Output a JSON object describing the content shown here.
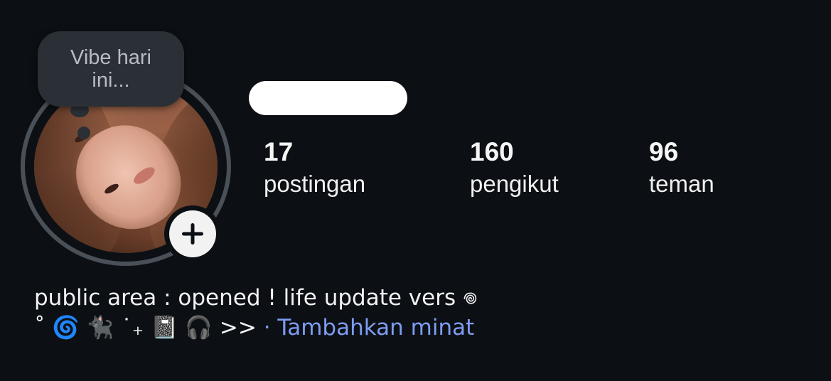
{
  "profile": {
    "vibe_prompt": "Vibe hari ini...",
    "stats": [
      {
        "value": "17",
        "label": "postingan"
      },
      {
        "value": "160",
        "label": "pengikut"
      },
      {
        "value": "96",
        "label": "teman"
      }
    ],
    "bio": {
      "line1": "public area : opened ! life update vers 𖦹",
      "line2_prefix": "˚ 🌀 🐈‍⬛ ˙₊ 📓 🎧 >>",
      "line2_link": " · Tambahkan minat"
    }
  },
  "icons": {
    "add_story": "plus-icon"
  },
  "colors": {
    "background": "#0c1014",
    "link": "#7f9cf2",
    "bubble": "#2b3036"
  }
}
